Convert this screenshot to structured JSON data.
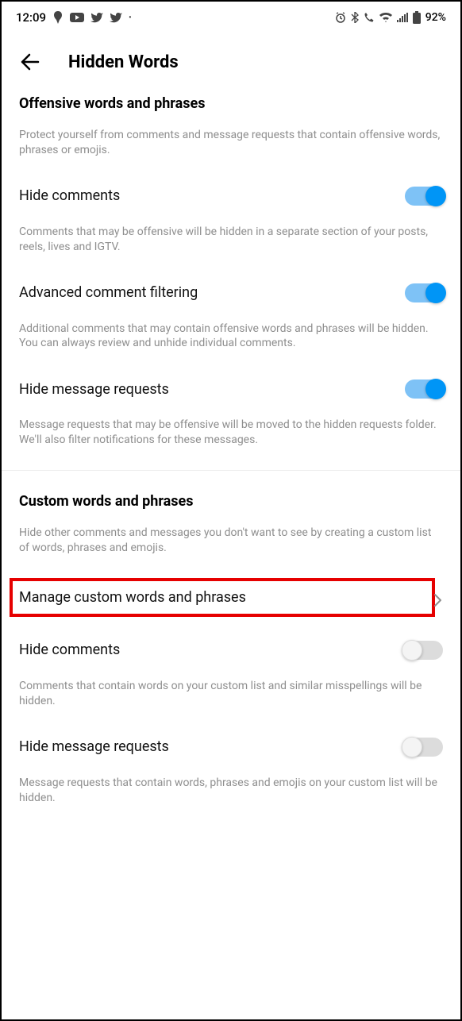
{
  "status": {
    "time": "12:09",
    "battery": "92%"
  },
  "header": {
    "title": "Hidden Words"
  },
  "section1": {
    "title": "Offensive words and phrases",
    "desc": "Protect yourself from comments and message requests that contain offensive words, phrases or emojis.",
    "items": [
      {
        "label": "Hide comments",
        "desc": "Comments that may be offensive will be hidden in a separate section of your posts, reels, lives and IGTV.",
        "on": true
      },
      {
        "label": "Advanced comment filtering",
        "desc": "Additional comments that may contain offensive words and phrases will be hidden. You can always review and unhide individual comments.",
        "on": true
      },
      {
        "label": "Hide message requests",
        "desc": "Message requests that may be offensive will be moved to the hidden requests folder. We'll also filter notifications for these messages.",
        "on": true
      }
    ]
  },
  "section2": {
    "title": "Custom words and phrases",
    "desc": "Hide other comments and messages you don't want to see by creating a custom list of words, phrases and emojis.",
    "manage": "Manage custom words and phrases",
    "items": [
      {
        "label": "Hide comments",
        "desc": "Comments that contain words on your custom list and similar misspellings will be hidden.",
        "on": false
      },
      {
        "label": "Hide message requests",
        "desc": "Message requests that contain words, phrases and emojis on your custom list will be hidden.",
        "on": false
      }
    ]
  }
}
